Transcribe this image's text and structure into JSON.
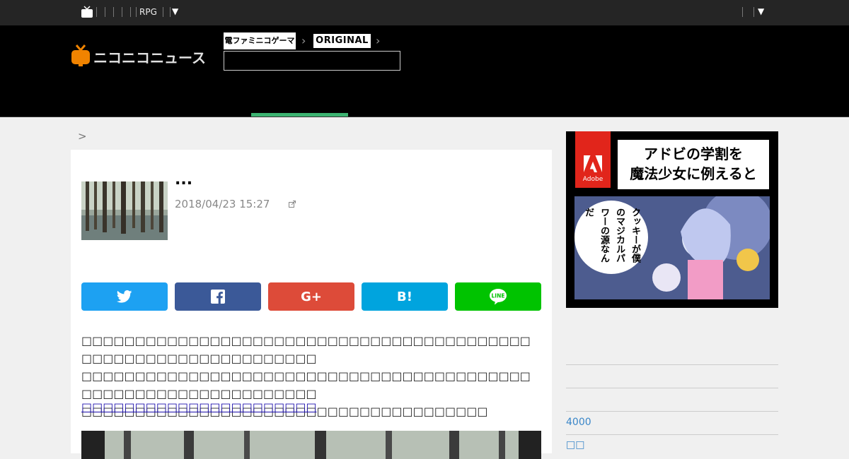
{
  "topbar": {
    "rpg_label": "RPG",
    "menu_arrow": "▼",
    "right_arrow": "▼"
  },
  "header": {
    "logo_text": "ニコニコニュース",
    "breadcrumb_1": "電ファミニコゲーマー",
    "breadcrumb_2": "ORIGINAL"
  },
  "breadcrumb": ">",
  "article": {
    "title": "...",
    "date": "2018/04/23 15:27",
    "share_buttons": [
      "twitter",
      "facebook",
      "google-plus",
      "hatena",
      "line"
    ],
    "hatena_label": "B!",
    "line_label": "LINE",
    "gplus_label": "G+",
    "body_lines": [
      "□□□□□□□□□□□□□□□□□□□□□□□□□□□□□□□□□□□□□□□□□□□□□□□□□□□□□□□□□□□□□□□□",
      "□□□□□□□□□□□□□□□□□□□□□□□□□□□□□□□□□□□□□□□□□□□□□□□□□□□□□□□□□□□□□□□□",
      "□□□□□□□□□□□□□□□□□□□□□□□□□□□□□□□□□□□□□□"
    ],
    "link_text": "□□□□□□□□□□□□□□□□□□□□□□"
  },
  "ad": {
    "brand": "Adobe",
    "headline_1": "アドビの学割を",
    "headline_2": "魔法少女に例えると",
    "bubble": "クッキーが僕のマジカルパワーの源なんだ"
  },
  "sidebar": {
    "item_4000": "4000",
    "item_partial": "□□"
  },
  "colors": {
    "twitter": "#1da1f2",
    "facebook": "#3b5998",
    "gplus": "#dd4b39",
    "hatena": "#00a4de",
    "line": "#00c300",
    "accent_green": "#3cb371"
  }
}
